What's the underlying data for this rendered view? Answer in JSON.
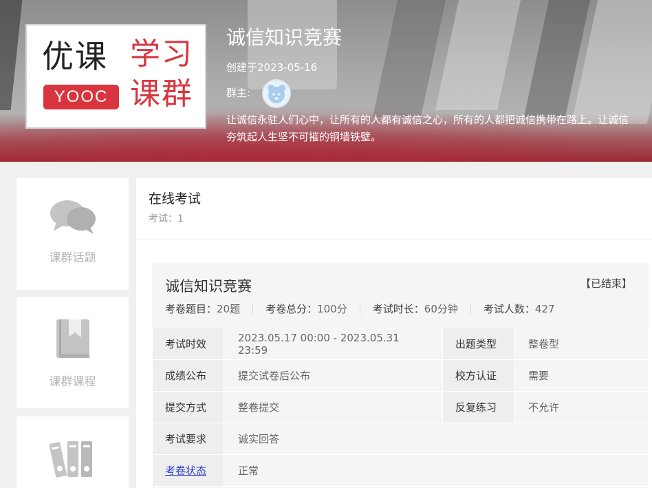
{
  "banner": {
    "logo": {
      "youke": "优课",
      "yooc": "YOOC",
      "xuexi": "学习",
      "kequn": "课群"
    },
    "title": "诚信知识竞赛",
    "created": "创建于2023-05-16",
    "owner_label": "群主:",
    "description_line1": "让诚信永驻人们心中，让所有的人都有诚信之心，所有的人都把诚信携带在路上。让诚信",
    "description_line2": "夯筑起人生坚不可摧的铜墙铁壁。"
  },
  "sidebar": {
    "items": [
      {
        "label": "课群话题",
        "icon": "chat-bubbles-icon"
      },
      {
        "label": "课群课程",
        "icon": "book-icon"
      },
      {
        "label": "",
        "icon": "binders-icon"
      }
    ]
  },
  "main": {
    "title": "在线考试",
    "count": "考试：1"
  },
  "exam": {
    "title": "诚信知识竞赛",
    "status": "【已结束】",
    "stats": [
      {
        "label": "考卷题目：",
        "value": "20题"
      },
      {
        "label": "考卷总分：",
        "value": "100分"
      },
      {
        "label": "考试时长：",
        "value": "60分钟"
      },
      {
        "label": "考试人数：",
        "value": "427"
      }
    ],
    "rows": [
      {
        "k1": "考试时效",
        "v1": "2023.05.17 00:00 - 2023.05.31 23:59",
        "k2": "出题类型",
        "v2": "整卷型"
      },
      {
        "k1": "成绩公布",
        "v1": "提交试卷后公布",
        "k2": "校方认证",
        "v2": "需要"
      },
      {
        "k1": "提交方式",
        "v1": "整卷提交",
        "k2": "反复练习",
        "v2": "不允许"
      },
      {
        "k1": "考试要求",
        "v1": "诚实回答"
      },
      {
        "k1": "考卷状态",
        "v1": "正常"
      }
    ]
  },
  "colors": {
    "brand_red": "#d8353f",
    "link_blue": "#2b3dc8"
  }
}
